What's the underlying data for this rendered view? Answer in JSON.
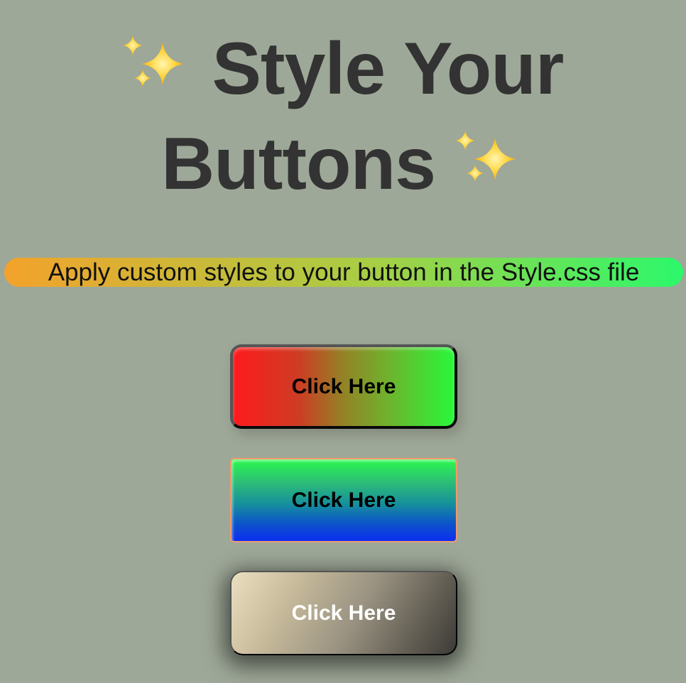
{
  "heading": {
    "line1_text": "Style Your",
    "line2_text": "Buttons",
    "leading_icon": "sparkles-icon",
    "trailing_icon": "sparkles-icon",
    "color": "#333333"
  },
  "subtitle": {
    "text": "Apply custom styles to your button in the Style.css file",
    "gradient_start": "#f3a22b",
    "gradient_end": "#2cf86b"
  },
  "buttons": [
    {
      "label": "Click Here",
      "style": "red-to-green horizontal gradient, dark border",
      "text_color": "#000000"
    },
    {
      "label": "Click Here",
      "style": "green-to-blue vertical gradient, salmon border",
      "text_color": "#000000"
    },
    {
      "label": "Click Here",
      "style": "beige-to-dark diagonal gradient, heavy shadow",
      "text_color": "#ffffff"
    }
  ],
  "background_color": "#9ea898"
}
